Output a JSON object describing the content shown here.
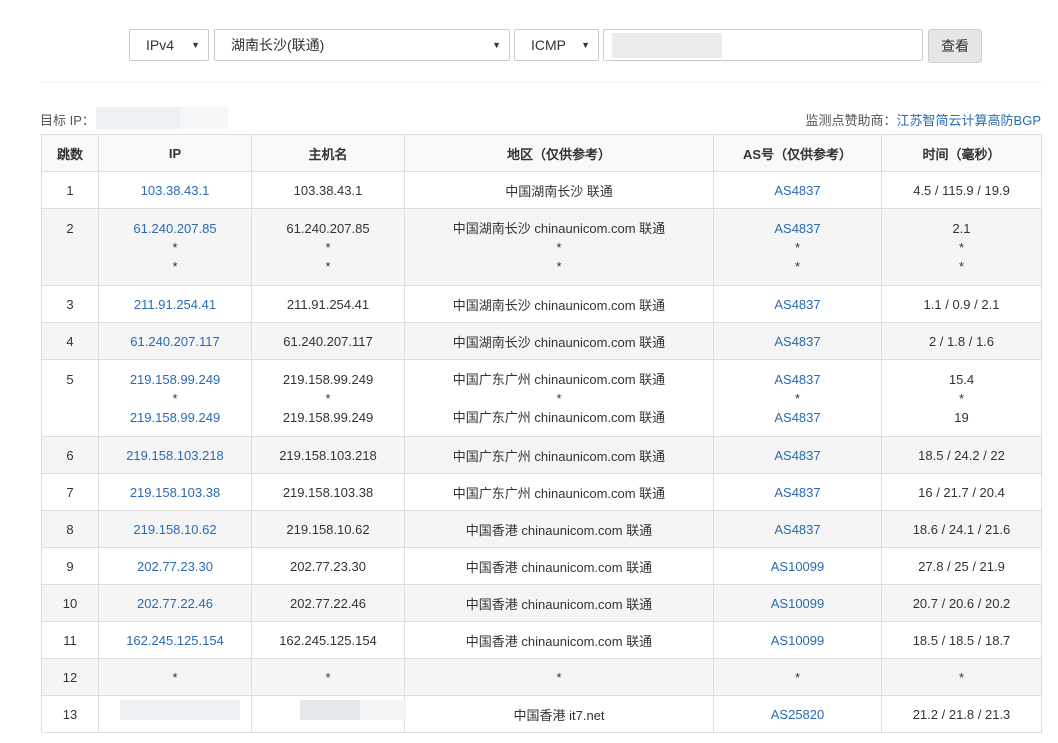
{
  "toolbar": {
    "protocol": "IPv4",
    "node": "湖南长沙(联通)",
    "method": "ICMP",
    "query_label": "查看"
  },
  "info": {
    "target_label": "目标 IP：",
    "sponsor_label": "监测点赞助商：",
    "sponsor_name": "江苏智简云计算高防BGP"
  },
  "table": {
    "headers": [
      "跳数",
      "IP",
      "主机名",
      "地区（仅供参考）",
      "AS号（仅供参考）",
      "时间（毫秒）"
    ],
    "rows": [
      {
        "hop": "1",
        "ip": [
          "103.38.43.1"
        ],
        "host": [
          "103.38.43.1"
        ],
        "region": [
          "中国湖南长沙 联通"
        ],
        "as": [
          "AS4837"
        ],
        "time": [
          "4.5 / 115.9 / 19.9"
        ]
      },
      {
        "hop": "2",
        "ip": [
          "61.240.207.85",
          "*",
          "*"
        ],
        "host": [
          "61.240.207.85",
          "*",
          "*"
        ],
        "region": [
          "中国湖南长沙 chinaunicom.com 联通",
          "*",
          "*"
        ],
        "as": [
          "AS4837",
          "*",
          "*"
        ],
        "time": [
          "2.1",
          "*",
          "*"
        ]
      },
      {
        "hop": "3",
        "ip": [
          "211.91.254.41"
        ],
        "host": [
          "211.91.254.41"
        ],
        "region": [
          "中国湖南长沙 chinaunicom.com 联通"
        ],
        "as": [
          "AS4837"
        ],
        "time": [
          "1.1 / 0.9 / 2.1"
        ]
      },
      {
        "hop": "4",
        "ip": [
          "61.240.207.117"
        ],
        "host": [
          "61.240.207.117"
        ],
        "region": [
          "中国湖南长沙 chinaunicom.com 联通"
        ],
        "as": [
          "AS4837"
        ],
        "time": [
          "2 / 1.8 / 1.6"
        ]
      },
      {
        "hop": "5",
        "ip": [
          "219.158.99.249",
          "*",
          "219.158.99.249"
        ],
        "host": [
          "219.158.99.249",
          "*",
          "219.158.99.249"
        ],
        "region": [
          "中国广东广州 chinaunicom.com 联通",
          "*",
          "中国广东广州 chinaunicom.com 联通"
        ],
        "as": [
          "AS4837",
          "*",
          "AS4837"
        ],
        "time": [
          "15.4",
          "*",
          "19"
        ]
      },
      {
        "hop": "6",
        "ip": [
          "219.158.103.218"
        ],
        "host": [
          "219.158.103.218"
        ],
        "region": [
          "中国广东广州 chinaunicom.com 联通"
        ],
        "as": [
          "AS4837"
        ],
        "time": [
          "18.5 / 24.2 / 22"
        ]
      },
      {
        "hop": "7",
        "ip": [
          "219.158.103.38"
        ],
        "host": [
          "219.158.103.38"
        ],
        "region": [
          "中国广东广州 chinaunicom.com 联通"
        ],
        "as": [
          "AS4837"
        ],
        "time": [
          "16 / 21.7 / 20.4"
        ]
      },
      {
        "hop": "8",
        "ip": [
          "219.158.10.62"
        ],
        "host": [
          "219.158.10.62"
        ],
        "region": [
          "中国香港 chinaunicom.com 联通"
        ],
        "as": [
          "AS4837"
        ],
        "time": [
          "18.6 / 24.1 / 21.6"
        ]
      },
      {
        "hop": "9",
        "ip": [
          "202.77.23.30"
        ],
        "host": [
          "202.77.23.30"
        ],
        "region": [
          "中国香港 chinaunicom.com 联通"
        ],
        "as": [
          "AS10099"
        ],
        "time": [
          "27.8 / 25 / 21.9"
        ]
      },
      {
        "hop": "10",
        "ip": [
          "202.77.22.46"
        ],
        "host": [
          "202.77.22.46"
        ],
        "region": [
          "中国香港 chinaunicom.com 联通"
        ],
        "as": [
          "AS10099"
        ],
        "time": [
          "20.7 / 20.6 / 20.2"
        ]
      },
      {
        "hop": "11",
        "ip": [
          "162.245.125.154"
        ],
        "host": [
          "162.245.125.154"
        ],
        "region": [
          "中国香港 chinaunicom.com 联通"
        ],
        "as": [
          "AS10099"
        ],
        "time": [
          "18.5 / 18.5 / 18.7"
        ]
      },
      {
        "hop": "12",
        "ip": [
          "*"
        ],
        "host": [
          "*"
        ],
        "region": [
          "*"
        ],
        "as": [
          "*"
        ],
        "time": [
          "*"
        ]
      },
      {
        "hop": "13",
        "ip": [
          ""
        ],
        "host": [
          ""
        ],
        "region": [
          "中国香港 it7.net"
        ],
        "as": [
          "AS25820"
        ],
        "time": [
          "21.2 / 21.8 / 21.3"
        ]
      }
    ]
  },
  "colors": {
    "link": "#2a6ab1",
    "border": "#dddddd",
    "shade": "#f5f5f5"
  },
  "icons": {
    "dropdown": "caret-down-icon"
  }
}
